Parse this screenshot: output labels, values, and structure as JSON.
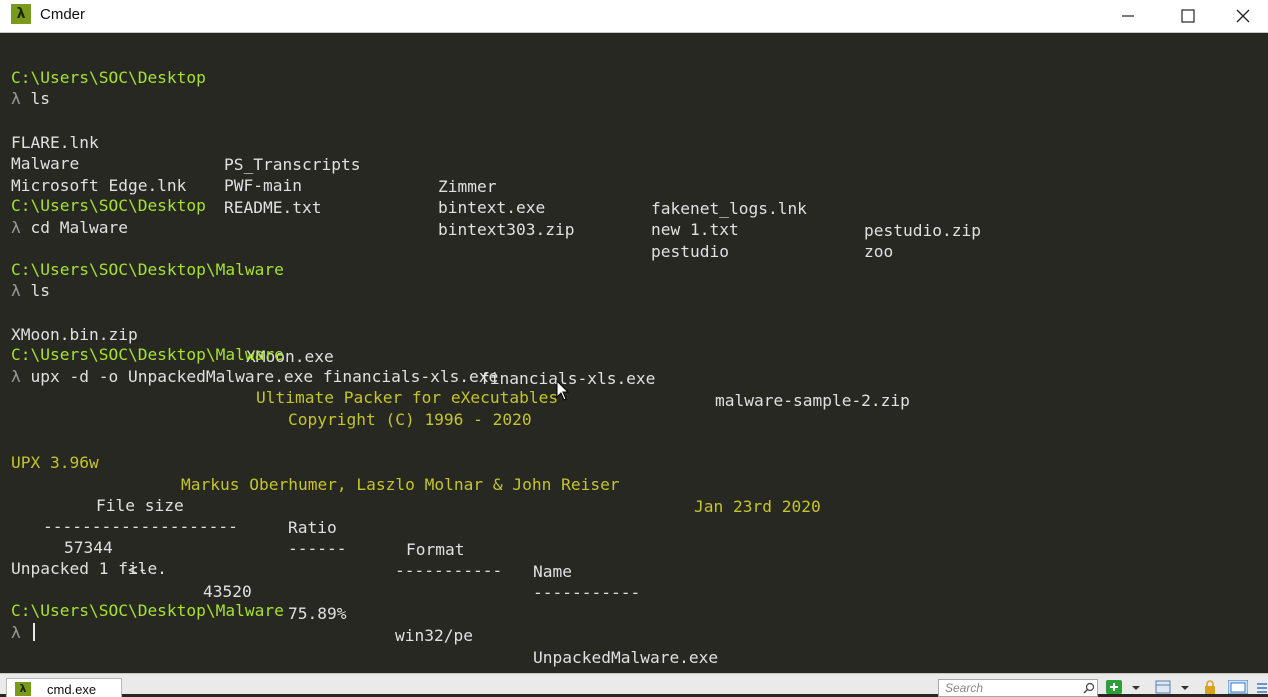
{
  "window": {
    "app_icon": "λ",
    "title": "Cmder",
    "controls": [
      "minimize-icon",
      "maximize-icon",
      "close-icon"
    ]
  },
  "terminal": {
    "prompt_symbol": "λ",
    "paths": {
      "desktop": "C:\\Users\\SOC\\Desktop",
      "malware": "C:\\Users\\SOC\\Desktop\\Malware"
    },
    "commands": {
      "ls1": "ls",
      "cd": "cd Malware",
      "ls2": "ls",
      "upx": "upx -d -o UnpackedMalware.exe financials-xls.exe"
    },
    "desktop_listing": [
      [
        "FLARE.lnk",
        "PS_Transcripts",
        "Zimmer",
        "fakenet_logs.lnk",
        "pestudio.zip"
      ],
      [
        "Malware",
        "PWF-main",
        "bintext.exe",
        "new 1.txt",
        "zoo"
      ],
      [
        "Microsoft Edge.lnk",
        "README.txt",
        "bintext303.zip",
        "pestudio",
        ""
      ]
    ],
    "malware_listing": [
      "XMoon.bin.zip",
      "XMoon.exe",
      "financials-xls.exe",
      "malware-sample-2.zip"
    ],
    "upx_banner": {
      "line1": "Ultimate Packer for eXecutables",
      "line2": "Copyright (C) 1996 - 2020",
      "version": "UPX 3.96w",
      "authors": "Markus Oberhumer, Laszlo Molnar & John Reiser",
      "date": "Jan 23rd 2020"
    },
    "upx_table": {
      "headers": [
        "File size",
        "Ratio",
        "Format",
        "Name"
      ],
      "dividers": [
        "--------------------",
        "------",
        "-----------",
        "-----------"
      ],
      "row": {
        "orig_size": "57344",
        "arrow": "<-",
        "new_size": "43520",
        "ratio": "75.89%",
        "format": "win32/pe",
        "name": "UnpackedMalware.exe"
      }
    },
    "result": "Unpacked 1 file."
  },
  "statusbar": {
    "tab_icon": "λ",
    "tab_label": "cmd.exe",
    "search_placeholder": "Search",
    "icons": [
      "search-icon",
      "new-console-icon",
      "dropdown-arrow-icon",
      "split-view-icon",
      "dropdown-arrow-icon",
      "lock-icon",
      "layout-icon",
      "menu-icon"
    ]
  },
  "colors": {
    "background": "#272822",
    "path": "#a6e22e",
    "text": "#e0e0e0",
    "upx_banner": "#c4c42c"
  }
}
